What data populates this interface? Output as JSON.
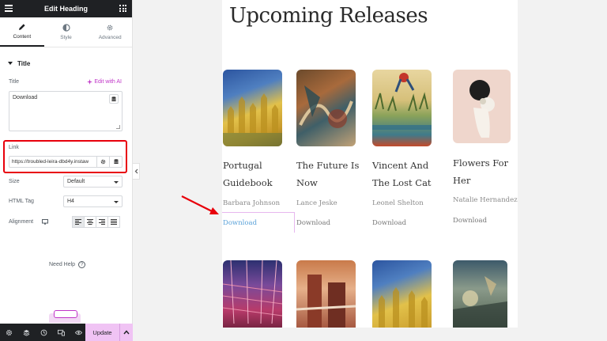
{
  "panel": {
    "title": "Edit Heading",
    "tabs": [
      {
        "label": "Content",
        "icon": "pencil-icon"
      },
      {
        "label": "Style",
        "icon": "half-circle-icon"
      },
      {
        "label": "Advanced",
        "icon": "gear-icon"
      }
    ],
    "section_title": "Title",
    "title_label": "Title",
    "ai_label": "Edit with AI",
    "title_value": "Download",
    "link_label": "Link",
    "link_value": "https://troubled-leira-dbd4y.instaw",
    "size_label": "Size",
    "size_value": "Default",
    "html_tag_label": "HTML Tag",
    "html_tag_value": "H4",
    "alignment_label": "Alignment",
    "need_help": "Need Help",
    "update_label": "Update",
    "accent_color": "#c036c8",
    "highlight_color": "#e8000b"
  },
  "page": {
    "title": "Upcoming Releases",
    "books": [
      {
        "title": "Portugal Guidebook",
        "author": "Barbara Johnson",
        "download": "Download"
      },
      {
        "title": "The Future Is Now",
        "author": "Lance Jeske",
        "download": "Download"
      },
      {
        "title": "Vincent And The Lost Cat",
        "author": "Leonel Shelton",
        "download": "Download"
      },
      {
        "title": "Flowers For Her",
        "author": "Natalie Hernandez",
        "download": "Download"
      }
    ],
    "link_color": "#5aa2d9"
  }
}
